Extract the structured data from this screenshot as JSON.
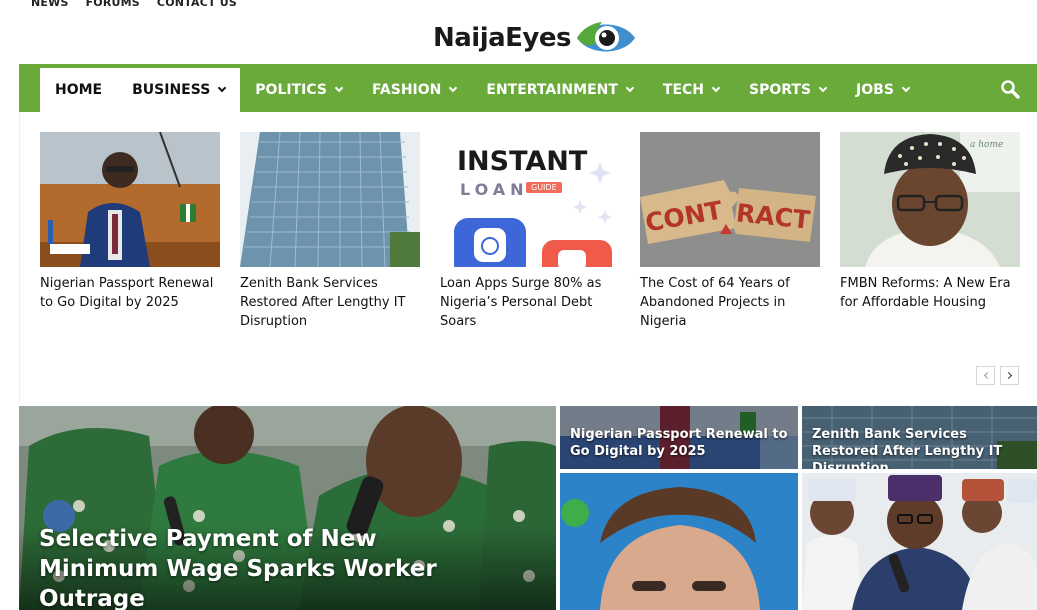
{
  "top_links": [
    "NEWS",
    "FORUMS",
    "CONTACT US"
  ],
  "logo": {
    "text": "NaijaEyes"
  },
  "nav": {
    "items": [
      {
        "label": "HOME",
        "dropdown": false,
        "active": true
      },
      {
        "label": "BUSINESS",
        "dropdown": true,
        "hover": true
      },
      {
        "label": "POLITICS",
        "dropdown": true
      },
      {
        "label": "FASHION",
        "dropdown": true
      },
      {
        "label": "ENTERTAINMENT",
        "dropdown": true
      },
      {
        "label": "TECH",
        "dropdown": true
      },
      {
        "label": "SPORTS",
        "dropdown": true
      },
      {
        "label": "JOBS",
        "dropdown": true
      }
    ],
    "search_icon": "search-icon"
  },
  "mega_menu": {
    "cards": [
      {
        "title": "Nigerian Passport Renewal to Go Digital by 2025",
        "thumb_text": "",
        "thumb_sub": ""
      },
      {
        "title": "Zenith Bank Services Restored After Lengthy IT Disruption",
        "thumb_text": "",
        "thumb_sub": ""
      },
      {
        "title": "Loan Apps Surge 80% as Nigeria’s Personal Debt Soars",
        "thumb_text": "INSTANT",
        "thumb_sub": "LOAN",
        "thumb_badge": "GUIDE"
      },
      {
        "title": "The Cost of 64 Years of Abandoned Projects in Nigeria",
        "thumb_text": "CONT",
        "thumb_sub": "RACT"
      },
      {
        "title": "FMBN Reforms: A New Era for Affordable Housing",
        "thumb_text": "a home",
        "thumb_sub": ""
      }
    ]
  },
  "featured": {
    "main": {
      "title": "Selective Payment of New Minimum Wage Sparks Worker Outrage"
    },
    "side": [
      {
        "title": "Nigerian Passport Renewal to Go Digital by 2025"
      },
      {
        "title": "Zenith Bank Services Restored After Lengthy IT Disruption"
      },
      {
        "title": ""
      },
      {
        "title": ""
      }
    ]
  },
  "colors": {
    "nav_green": "#6aaa3a",
    "accent_red": "#e5533d"
  }
}
